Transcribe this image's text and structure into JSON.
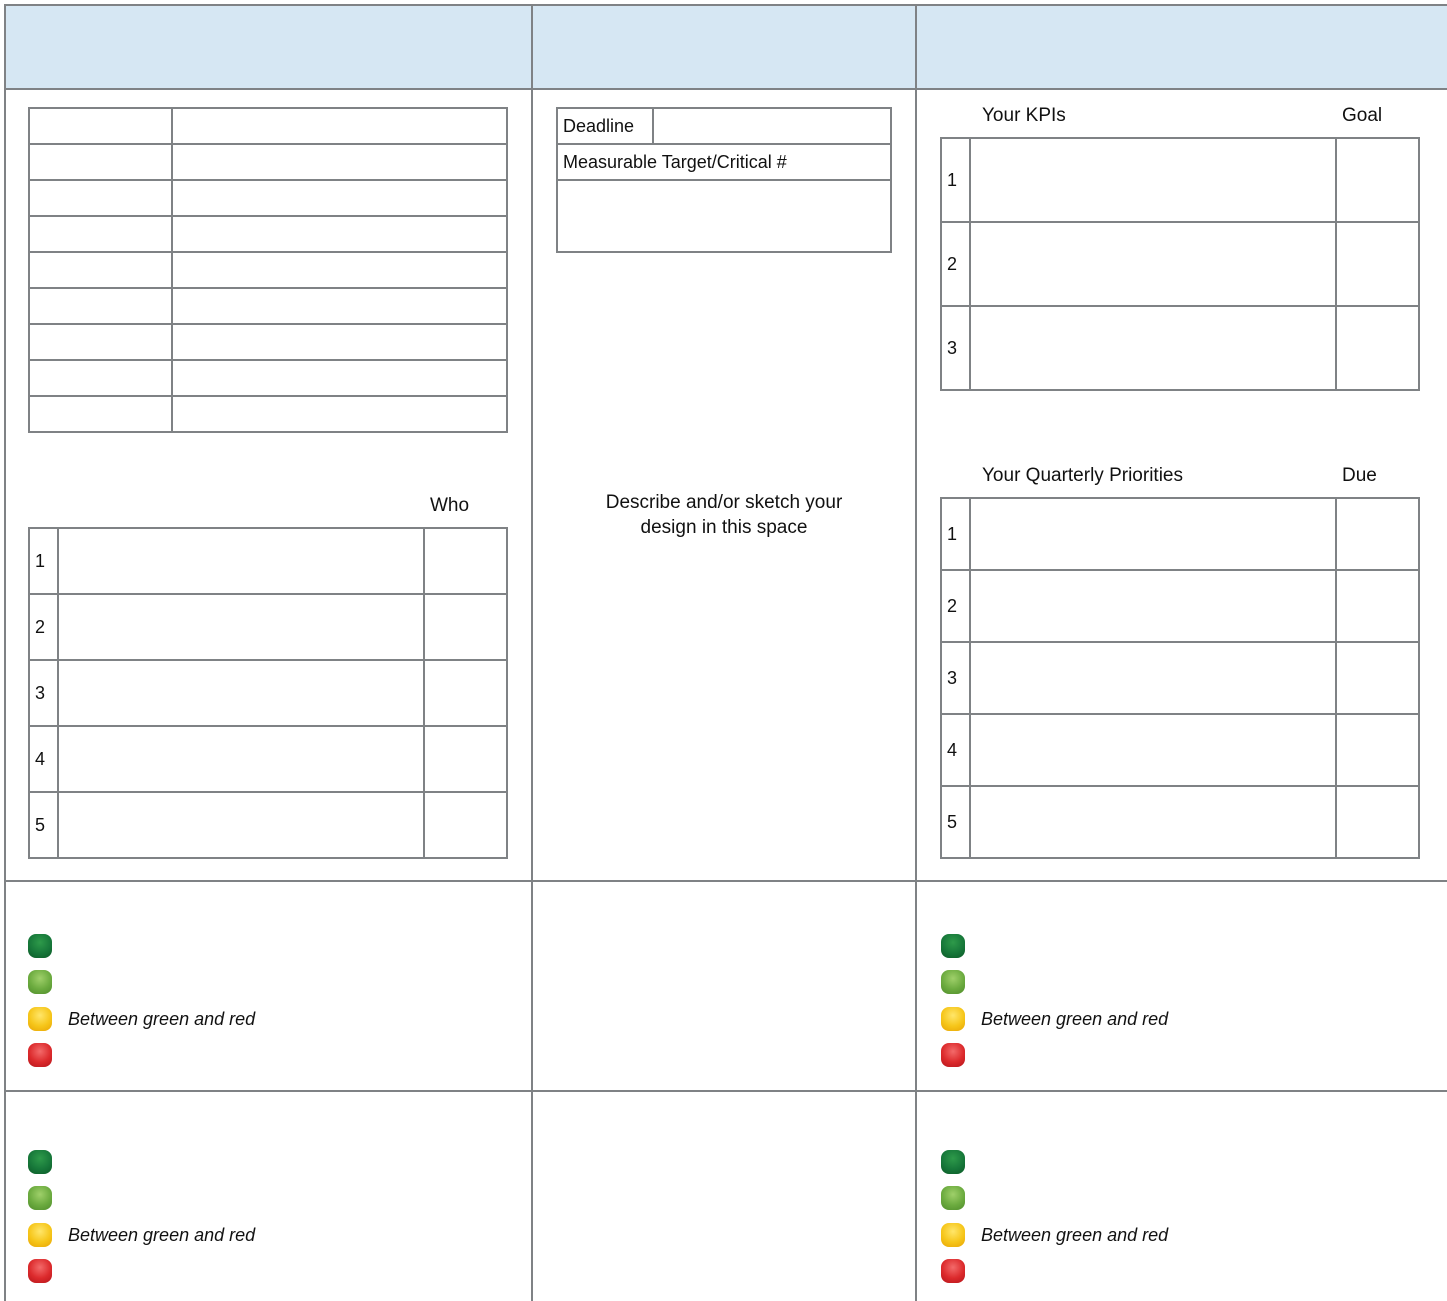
{
  "colors": {
    "header_fill": "#d6e7f3",
    "grid_lines": "#7f8285",
    "status_dark_green": "#17783a",
    "status_light_green": "#6cab3f",
    "status_yellow": "#f6c61a",
    "status_red": "#dc2a2c"
  },
  "left": {
    "who_label": "Who",
    "rows": [
      "1",
      "2",
      "3",
      "4",
      "5"
    ]
  },
  "middle": {
    "deadline_label": "Deadline",
    "target_label": "Measurable Target/Critical #",
    "sketch_line1": "Describe and/or sketch your",
    "sketch_line2": "design in this space"
  },
  "right": {
    "kpi_title": "Your KPIs",
    "goal_label": "Goal",
    "kpi_rows": [
      "1",
      "2",
      "3"
    ],
    "priorities_title": "Your Quarterly Priorities",
    "due_label": "Due",
    "priority_rows": [
      "1",
      "2",
      "3",
      "4",
      "5"
    ]
  },
  "status_legend": {
    "yellow_text": "Between green and red"
  }
}
